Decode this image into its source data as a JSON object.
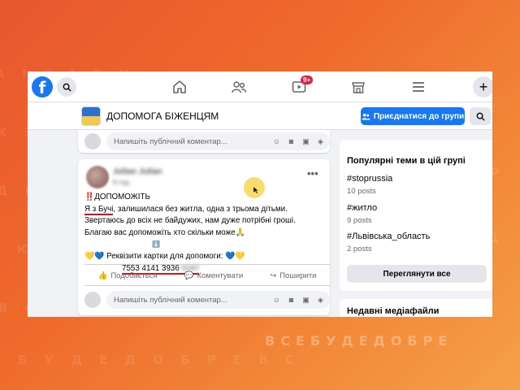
{
  "background": {
    "slogan": "ВСЕБУДЕДОБРЕ",
    "colors": {
      "gradient_start": "#e8572e",
      "gradient_end": "#f5a04a"
    }
  },
  "topbar": {
    "logo": "f",
    "notification_badge": "9+",
    "icons": [
      "facebook-logo",
      "search-icon",
      "home-icon",
      "friends-icon",
      "watch-icon",
      "marketplace-icon",
      "menu-icon",
      "plus-icon"
    ]
  },
  "group": {
    "title": "ДОПОМОГА БІЖЕНЦЯМ",
    "join_label": "Приєднатися до групи"
  },
  "comment_placeholder": "Напишіть публічний коментар...",
  "post": {
    "author": "Julian Julian",
    "time": "6 год. · ",
    "lines": [
      {
        "prefix": "‼️",
        "text": "ДОПОМОЖІТЬ"
      },
      {
        "underlined": "Я з Бучі",
        "text": ", залишилася без житла, одна з трьома дітьми."
      },
      {
        "text": "Звертаюсь до всіх не байдужих, нам дуже потрібні гроші."
      },
      {
        "text": "Благаю вас допоможіть хто скільки може🙏"
      },
      {
        "text": "⬇️"
      },
      {
        "text": "💛💙 Реквізити картки для допомоги: 💙💛"
      },
      {
        "card_visible": "7553 4141 3936",
        "card_hidden": "0187"
      }
    ],
    "actions": {
      "like": "Подобається",
      "comment": "Коментувати",
      "share": "Поширити"
    }
  },
  "sidebar": {
    "topics_title": "Популярні теми в цій групі",
    "topics": [
      {
        "tag": "#stoprussia",
        "count": "10 posts"
      },
      {
        "tag": "#житло",
        "count": "9 posts"
      },
      {
        "tag": "#Львівська_область",
        "count": "2 posts"
      }
    ],
    "see_all": "Переглянути все",
    "media_title": "Недавні медіафайли"
  },
  "colors": {
    "accent": "#1877f2",
    "badge": "#e41e3f",
    "underline": "#dd1111"
  }
}
